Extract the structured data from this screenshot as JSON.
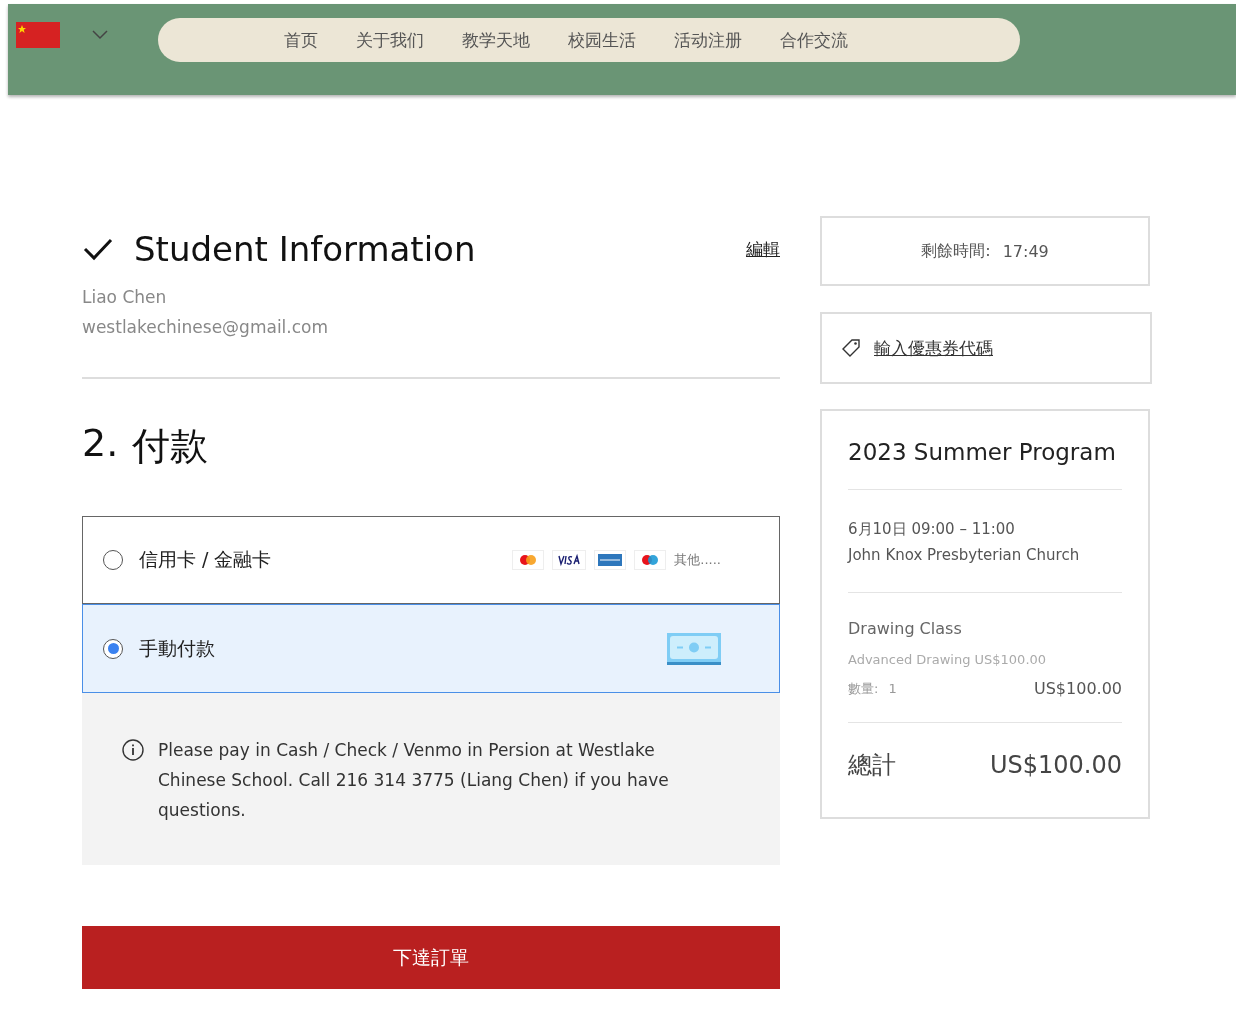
{
  "header": {
    "nav": [
      {
        "label": "首页",
        "selected": false
      },
      {
        "label": "关于我们",
        "selected": false
      },
      {
        "label": "教学天地",
        "selected": false
      },
      {
        "label": "校园生活",
        "selected": false
      },
      {
        "label": "活动注册",
        "selected": false
      },
      {
        "label": "合作交流",
        "selected": false
      }
    ]
  },
  "student": {
    "title": "Student Information",
    "edit": "編輯",
    "name": "Liao Chen",
    "email": "westlakechinese@gmail.com"
  },
  "payment": {
    "title_number": "2.",
    "title": "付款",
    "options": [
      {
        "kind": "card",
        "label": "信用卡 / 金融卡",
        "selected": false,
        "more": "其他....."
      },
      {
        "kind": "manual",
        "label": "手動付款",
        "selected": true
      }
    ],
    "note": "Please pay in Cash / Check / Venmo  in Persion at Westlake Chinese School. Call 216 314 3775 (Liang Chen) if you have questions."
  },
  "place_order": "下達訂單",
  "timer": {
    "label": "剩餘時間:",
    "value": "17:49"
  },
  "coupon": "輸入優惠券代碼",
  "summary": {
    "title": "2023 Summer Program",
    "date": "6月10日 09:00 – 11:00",
    "venue": "John Knox Presbyterian Church",
    "item": {
      "name": "Drawing Class",
      "option": "Advanced Drawing US$100.00",
      "qty_label": "數量:",
      "qty": "1",
      "price": "US$100.00"
    },
    "total_label": "總計",
    "total": "US$100.00"
  }
}
